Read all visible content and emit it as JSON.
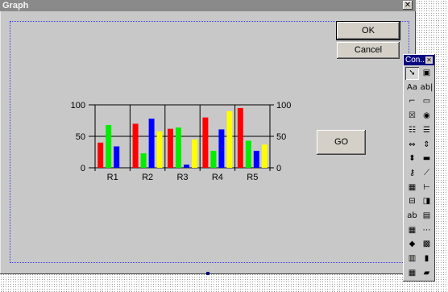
{
  "window": {
    "title": "Graph"
  },
  "buttons": {
    "ok": "OK",
    "cancel": "Cancel",
    "go": "GO",
    "close": "✕"
  },
  "toolbox": {
    "title": "Con...",
    "close": "✕",
    "tools": [
      {
        "icon": "pointer-icon",
        "glyph": "➘"
      },
      {
        "icon": "picturebox-icon",
        "glyph": "▣"
      },
      {
        "icon": "label-icon",
        "glyph": "Aa"
      },
      {
        "icon": "textbox-icon",
        "glyph": "ab|"
      },
      {
        "icon": "frame-icon",
        "glyph": "⌐"
      },
      {
        "icon": "commandbutton-icon",
        "glyph": "▭"
      },
      {
        "icon": "checkbox-icon",
        "glyph": "☒"
      },
      {
        "icon": "optionbutton-icon",
        "glyph": "◉"
      },
      {
        "icon": "combobox-icon",
        "glyph": "☷"
      },
      {
        "icon": "listbox-icon",
        "glyph": "☰"
      },
      {
        "icon": "hscrollbar-icon",
        "glyph": "⇔"
      },
      {
        "icon": "vscrollbar-icon",
        "glyph": "⇕"
      },
      {
        "icon": "spinbutton-icon",
        "glyph": "⬍"
      },
      {
        "icon": "timer-icon",
        "glyph": "▬"
      },
      {
        "icon": "key-icon",
        "glyph": "⚷"
      },
      {
        "icon": "line-icon",
        "glyph": "⟋"
      },
      {
        "icon": "grid-icon",
        "glyph": "▦"
      },
      {
        "icon": "tree-icon",
        "glyph": "⊢"
      },
      {
        "icon": "tabstrip-icon",
        "glyph": "⊟"
      },
      {
        "icon": "shape-icon",
        "glyph": "◨"
      },
      {
        "icon": "richtext-icon",
        "glyph": "ab"
      },
      {
        "icon": "image-icon",
        "glyph": "▤"
      },
      {
        "icon": "table-icon",
        "glyph": "▦"
      },
      {
        "icon": "dots-icon",
        "glyph": "⋯"
      },
      {
        "icon": "ole-icon",
        "glyph": "◆"
      },
      {
        "icon": "form-icon",
        "glyph": "▩"
      },
      {
        "icon": "chart-tool-icon",
        "glyph": "▥"
      },
      {
        "icon": "bars-icon",
        "glyph": "▮"
      },
      {
        "icon": "data-icon",
        "glyph": "▦"
      },
      {
        "icon": "colorbars-icon",
        "glyph": "▰"
      }
    ]
  },
  "chart_data": {
    "type": "bar",
    "categories": [
      "R1",
      "R2",
      "R3",
      "R4",
      "R5"
    ],
    "series": [
      {
        "color": "#ff0000",
        "values": [
          40,
          70,
          62,
          80,
          95
        ]
      },
      {
        "color": "#00ee00",
        "values": [
          68,
          23,
          64,
          27,
          43
        ]
      },
      {
        "color": "#0000ff",
        "values": [
          34,
          78,
          5,
          61,
          27
        ]
      },
      {
        "color": "#ffff00",
        "values": [
          0,
          58,
          45,
          90,
          37
        ]
      }
    ],
    "ylim": [
      0,
      100
    ],
    "yticks": [
      "100",
      "50",
      "0"
    ],
    "ytick_values": [
      100,
      50,
      0
    ],
    "grid": true,
    "legend": false
  }
}
